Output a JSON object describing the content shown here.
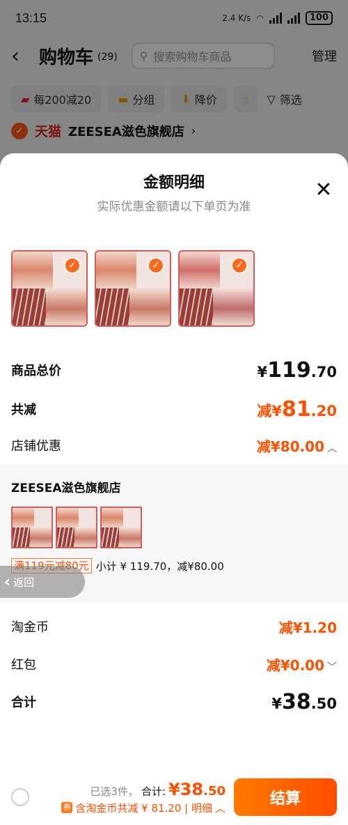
{
  "status_bar": {
    "time": "13:15",
    "net_speed": "2.4 K/s",
    "battery": "100"
  },
  "cart": {
    "title": "购物车",
    "count": "(29)",
    "search_placeholder": "搜索购物车商品",
    "manage": "管理",
    "filters": [
      {
        "label": "每200减20",
        "icon": "shop-icon"
      },
      {
        "label": "分组",
        "icon": "folder-icon"
      },
      {
        "label": "降价",
        "icon": "arrow-down-icon"
      },
      {
        "label": "",
        "icon": "hand-icon"
      },
      {
        "label": "筛选",
        "icon": "funnel-icon"
      }
    ],
    "store_brand": "天猫",
    "store_name": "ZEESEA滋色旗舰店"
  },
  "sheet": {
    "title": "金额明细",
    "subtitle": "实际优惠金额请以下单页为准",
    "rows": {
      "total": {
        "label": "商品总价",
        "currency": "¥",
        "int": "119",
        "dec": ".70"
      },
      "reduce": {
        "label": "共减",
        "prefix": "减¥",
        "int": "81",
        "dec": ".20"
      },
      "shop_discount": {
        "label": "店铺优惠",
        "value": "减¥80.00"
      },
      "coins": {
        "label": "淘金币",
        "value": "减¥1.20"
      },
      "red_packet": {
        "label": "红包",
        "value": "减¥0.00"
      },
      "sum": {
        "label": "合计",
        "currency": "¥",
        "int": "38",
        "dec": ".50"
      }
    },
    "detail": {
      "store": "ZEESEA滋色旗舰店",
      "promo_tag": "满119元减80元",
      "subtotal": "小计 ¥ 119.70，减¥80.00"
    },
    "return_label": "返回"
  },
  "bottom": {
    "selected": "已选3件，",
    "total_label": "合计:",
    "price_int": "¥38",
    "price_dec": ".50",
    "discount_note": "含淘金币共减 ¥ 81.20 | 明细",
    "checkout": "结算"
  },
  "colors": {
    "accent": "#ff5000",
    "tmall_red": "#e1251b"
  }
}
